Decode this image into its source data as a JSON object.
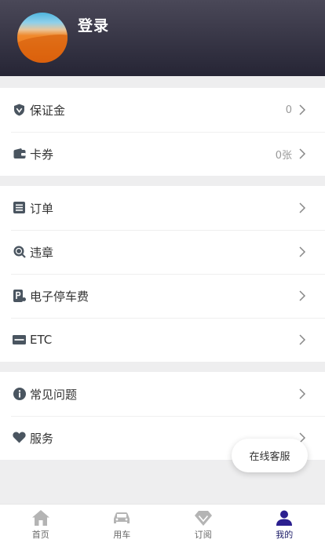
{
  "header": {
    "login_label": "登录"
  },
  "group1": [
    {
      "label": "保证金",
      "value": "0",
      "icon": "shield-icon"
    },
    {
      "label": "卡券",
      "value": "0张",
      "icon": "wallet-icon"
    }
  ],
  "group2": [
    {
      "label": "订单",
      "value": "",
      "icon": "list-icon"
    },
    {
      "label": "违章",
      "value": "",
      "icon": "violation-icon"
    },
    {
      "label": "电子停车费",
      "value": "",
      "icon": "parking-icon"
    },
    {
      "label": "ETC",
      "value": "",
      "icon": "etc-icon"
    }
  ],
  "group3": [
    {
      "label": "常见问题",
      "value": "",
      "icon": "info-icon"
    },
    {
      "label": "服务",
      "value": "",
      "icon": "heart-icon"
    }
  ],
  "float_button": {
    "label": "在线客服"
  },
  "tabbar": [
    {
      "label": "首页",
      "icon": "home-icon"
    },
    {
      "label": "用车",
      "icon": "car-icon"
    },
    {
      "label": "订阅",
      "icon": "diamond-icon"
    },
    {
      "label": "我的",
      "icon": "person-icon",
      "active": true
    }
  ],
  "colors": {
    "header_top": "#4a4858",
    "header_bottom": "#262535",
    "active_tab": "#2b1f8f",
    "icon_gray": "#4a5560"
  }
}
